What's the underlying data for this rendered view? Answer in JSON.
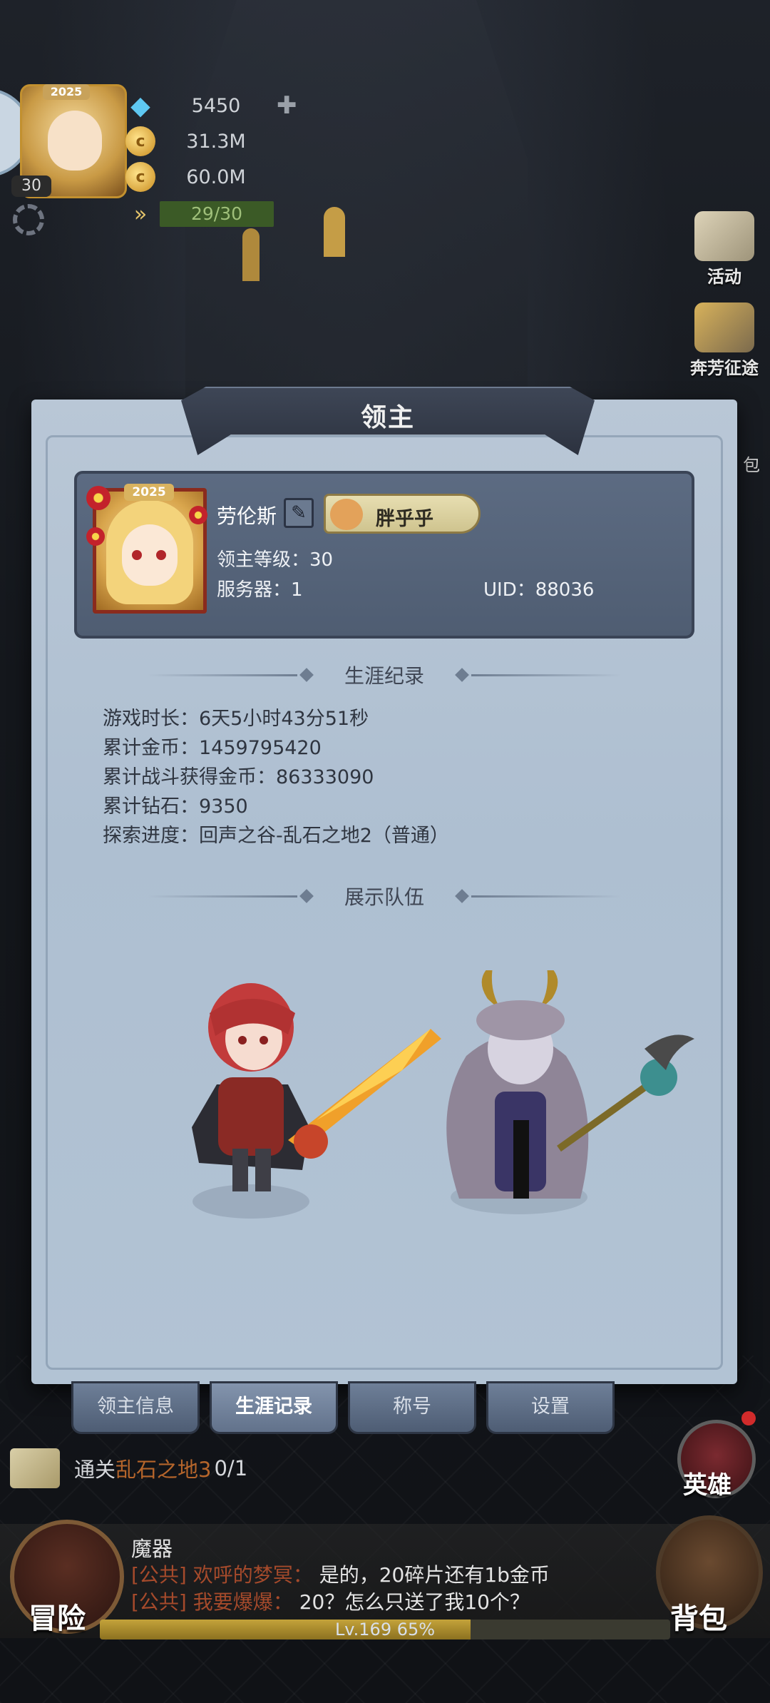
{
  "hud": {
    "portrait_year": "2025",
    "level": "30",
    "resources": [
      {
        "icon": "diamond-icon",
        "value": "5450"
      },
      {
        "icon": "coin-icon",
        "value": "31.3M"
      },
      {
        "icon": "coin-icon",
        "value": "60.0M"
      },
      {
        "icon": "stamina-icon",
        "value": "29/30"
      }
    ]
  },
  "side_menu": {
    "activity": "活动",
    "journey": "奔芳征途",
    "pack_partial": "包"
  },
  "panel": {
    "title": "领主",
    "lord": {
      "year_badge": "2025",
      "name": "劳伦斯",
      "title_badge": "胖乎乎",
      "level_text": "领主等级：30",
      "server_text": "服务器：1",
      "uid_text": "UID：88036"
    },
    "career_header": "生涯纪录",
    "stats": [
      "游戏时长：6天5小时43分51秒",
      "累计金币：1459795420",
      "累计战斗获得金币：86333090",
      "累计钻石：9350",
      "探索进度：回声之谷-乱石之地2（普通）"
    ],
    "team_header": "展示队伍"
  },
  "tabs": [
    {
      "label": "领主信息",
      "active": false
    },
    {
      "label": "生涯记录",
      "active": true
    },
    {
      "label": "称号",
      "active": false
    },
    {
      "label": "设置",
      "active": false
    }
  ],
  "quest": {
    "prefix": "通关",
    "target": "乱石之地3",
    "progress": "0/1"
  },
  "hero_button": "英雄",
  "chat": {
    "title": "魔器",
    "lines": [
      {
        "tag": "[公共]",
        "user": "欢呼的梦冥：",
        "msg": "是的，20碎片还有1b金币"
      },
      {
        "tag": "[公共]",
        "user": "我要爆爆：",
        "msg": "20？怎么只送了我10个？"
      }
    ]
  },
  "bottom": {
    "adventure": "冒险",
    "bag": "背包",
    "xp_text": "Lv.169  65%",
    "xp_fraction": 0.65
  },
  "colors": {
    "panel": "#b4c4d5",
    "card": "#55637a",
    "tab": "#5e6d85",
    "quest_highlight": "#b5652b"
  }
}
